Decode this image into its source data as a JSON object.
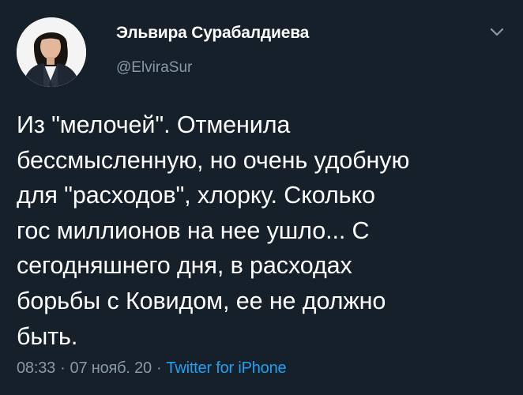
{
  "tweet": {
    "author": {
      "display_name": "Эльвира Сурабалдиева",
      "handle": "@ElviraSur",
      "avatar_icon": "profile-photo"
    },
    "menu_icon": "chevron-down-icon",
    "text_lines": [
      "Из \"мелочей\". Отменила",
      "бессмысленную, но очень удобную",
      "для \"расходов\", хлорку. Сколько",
      "гос миллионов на нее ушло... С",
      "сегодняшнего дня, в расходах",
      "борьбы с Ковидом, ее не должно",
      "быть."
    ],
    "meta": {
      "time": "08:33",
      "separator": "·",
      "date": "07 нояб. 20",
      "source": "Twitter for iPhone"
    }
  },
  "colors": {
    "background": "#15202b",
    "text": "#ffffff",
    "secondary": "#8899a6",
    "accent": "#1da1f2"
  }
}
